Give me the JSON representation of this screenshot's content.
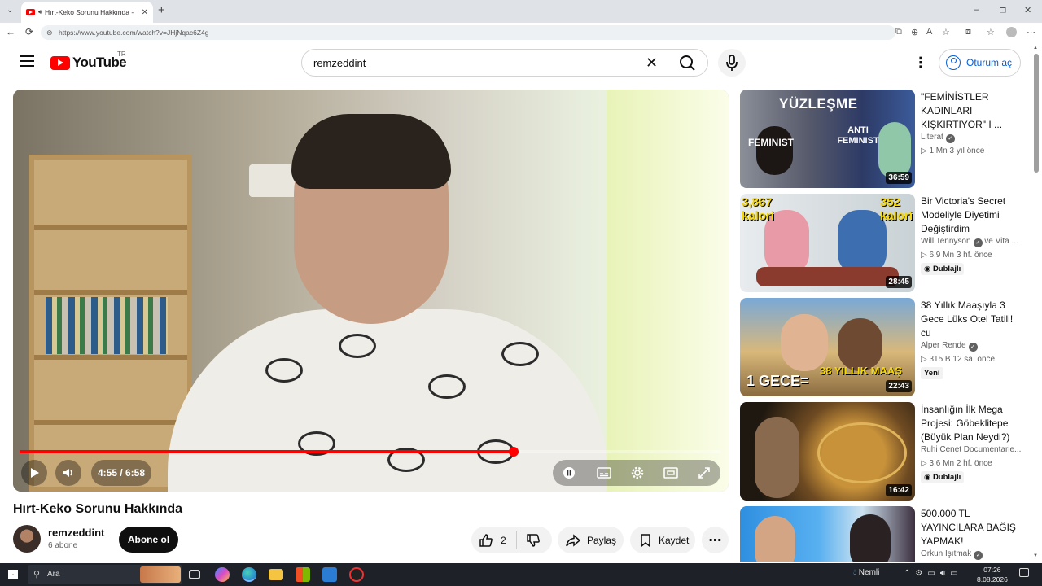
{
  "browser": {
    "tab_title": "Hırt-Keko Sorunu Hakkında -",
    "url": "https://www.youtube.com/watch?v=JHjNqac6Z4g"
  },
  "header": {
    "logo_text": "YouTube",
    "country_code": "TR",
    "search_value": "remzeddint",
    "sign_in_label": "Oturum aç"
  },
  "player": {
    "time": "4:55 / 6:58",
    "progress_fraction": 0.705
  },
  "video": {
    "title": "Hırt-Keko Sorunu Hakkında",
    "channel_name": "remzeddint",
    "subscribers": "6 abone",
    "subscribe_label": "Abone ol",
    "like_count": "2",
    "share_label": "Paylaş",
    "save_label": "Kaydet"
  },
  "recommendations": [
    {
      "title": "\"FEMİNİSTLER KADINLARI KIŞKIRTIYOR\" I ...",
      "channel": "Literat",
      "meta": "▷ 1 Mn   3 yıl önce",
      "duration": "36:59",
      "thumb_text_top": "YÜZLEŞME",
      "thumb_text_left": "FEMINIST",
      "thumb_text_right": "ANTI FEMINIST",
      "badge": ""
    },
    {
      "title": "Bir Victoria's Secret Modeliyle Diyetimi Değiştirdim",
      "channel": "Will Tennyson",
      "channel_extra": "ve Vita ...",
      "meta": "▷ 6,9 Mn   3 hf. önce",
      "duration": "28:45",
      "thumb_text_left": "3,867 kalori",
      "thumb_text_right": "352 kalori",
      "badge": "Dublajlı"
    },
    {
      "title": "38 Yıllık Maaşıyla 3 Gece Lüks Otel Tatili! cu",
      "channel": "Alper Rende",
      "meta": "▷ 315 B   12 sa. önce",
      "duration": "22:43",
      "thumb_text_left": "1 GECE=",
      "thumb_text_right": "38 YILLIK MAAŞ",
      "badge": "Yeni"
    },
    {
      "title": "İnsanlığın İlk Mega Projesi: Göbeklitepe (Büyük Plan Neydi?)",
      "channel": "Ruhi Cenet Documentarie...",
      "meta": "▷ 3,6 Mn   2 hf. önce",
      "duration": "16:42",
      "badge": "Dublajlı"
    },
    {
      "title": "500.000 TL YAYINCILARA BAĞIŞ YAPMAK!",
      "channel": "Orkun Işıtmak",
      "meta": "",
      "duration": "",
      "badge": ""
    }
  ],
  "taskbar": {
    "search_placeholder": "Ara",
    "weather": "Nemli",
    "time": "07:26",
    "date": "8.08.2026"
  }
}
